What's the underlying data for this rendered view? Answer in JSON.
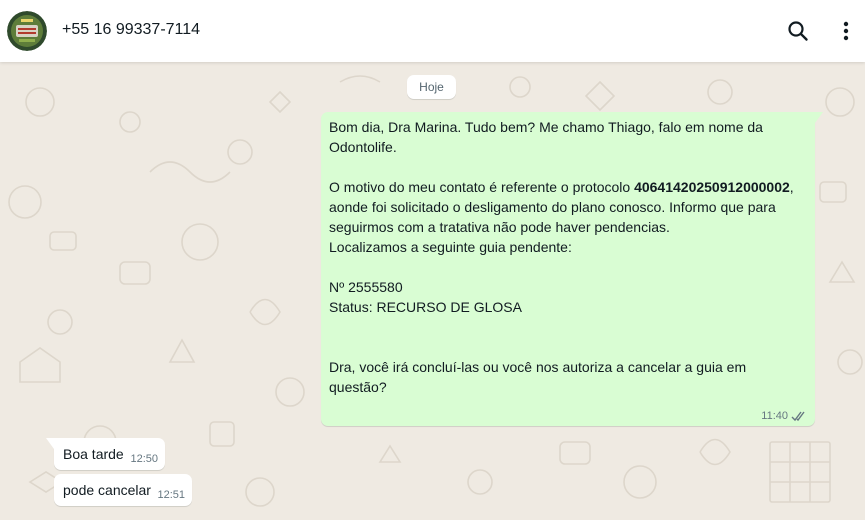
{
  "header": {
    "contact_name": "+55 16 99337-7114",
    "avatar_icon": "business-logo-avatar",
    "search_icon": "search-icon",
    "menu_icon": "kebab-menu-icon"
  },
  "chat": {
    "date_label": "Hoje",
    "outgoing": {
      "p1": "Bom dia, Dra Marina. Tudo bem? Me chamo Thiago, falo em nome da Odontolife.",
      "p2_before": "O motivo do meu contato é referente o protocolo ",
      "protocol": "4064142025091200000 2",
      "p2_after": ", aonde foi solicitado o desligamento do plano conosco. Informo que para seguirmos com a tratativa não pode haver pendencias.",
      "p3": "Localizamos a seguinte guia pendente:",
      "p4": "Nº 2555580",
      "p5": "Status: RECURSO DE GLOSA",
      "p6": "Dra, você irá concluí-las ou você nos autoriza a cancelar a guia em questão?",
      "time": "11:40",
      "status_icon": "double-check-read-icon"
    },
    "incoming": [
      {
        "text": "Boa tarde",
        "time": "12:50"
      },
      {
        "text": "pode cancelar",
        "time": "12:51"
      }
    ]
  },
  "colors": {
    "chat_bg": "#efeae2",
    "outgoing_bubble": "#d9fdd3",
    "incoming_bubble": "#ffffff",
    "header_bg": "#ffffff"
  }
}
